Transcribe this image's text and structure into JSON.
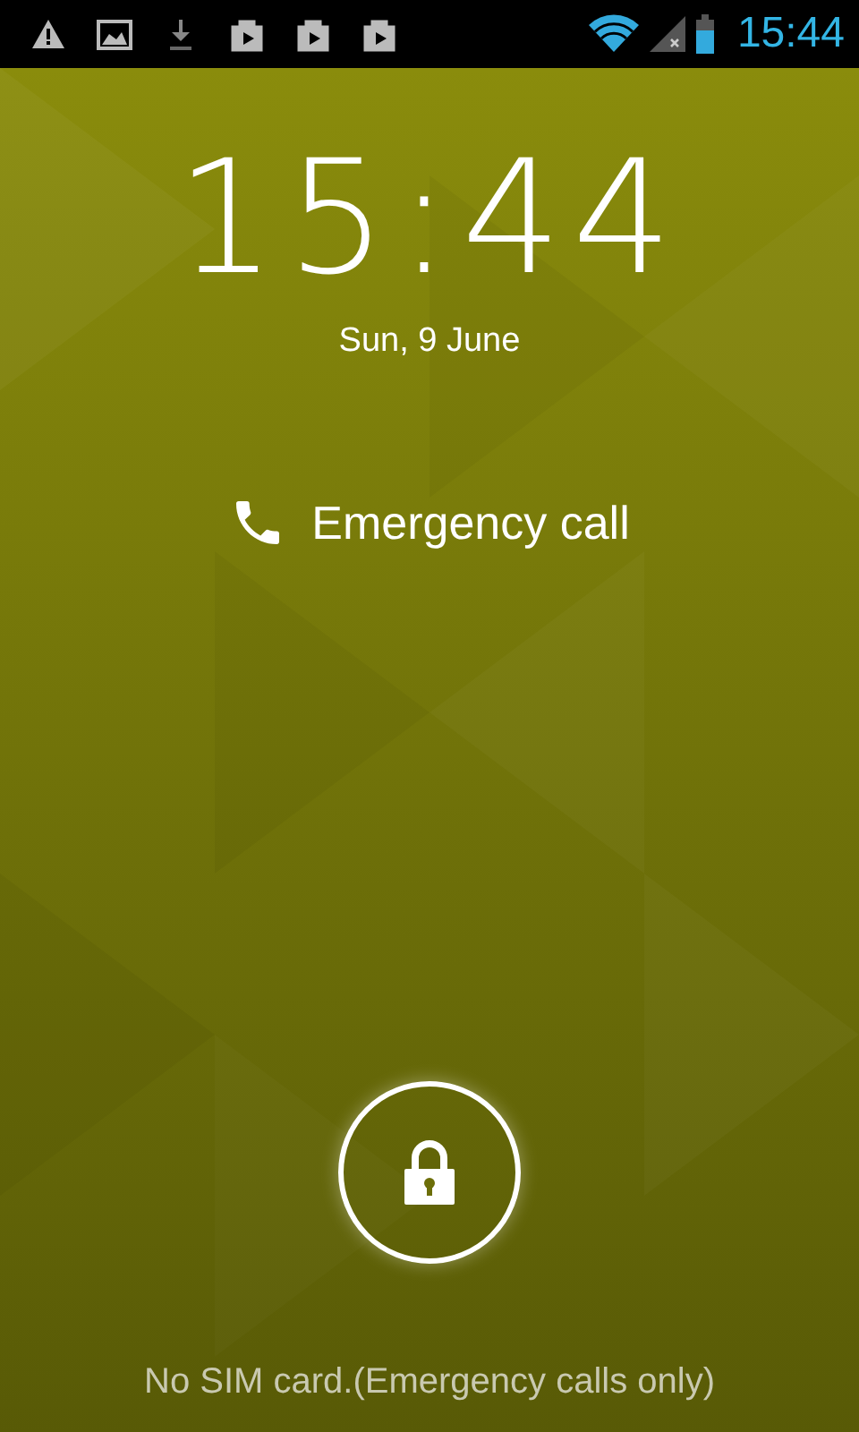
{
  "status_bar": {
    "time": "15:44"
  },
  "lockscreen": {
    "clock": "15:44",
    "date": "Sun, 9 June",
    "emergency_button": "Emergency call",
    "carrier_message": "No SIM card.(Emergency calls only)"
  }
}
